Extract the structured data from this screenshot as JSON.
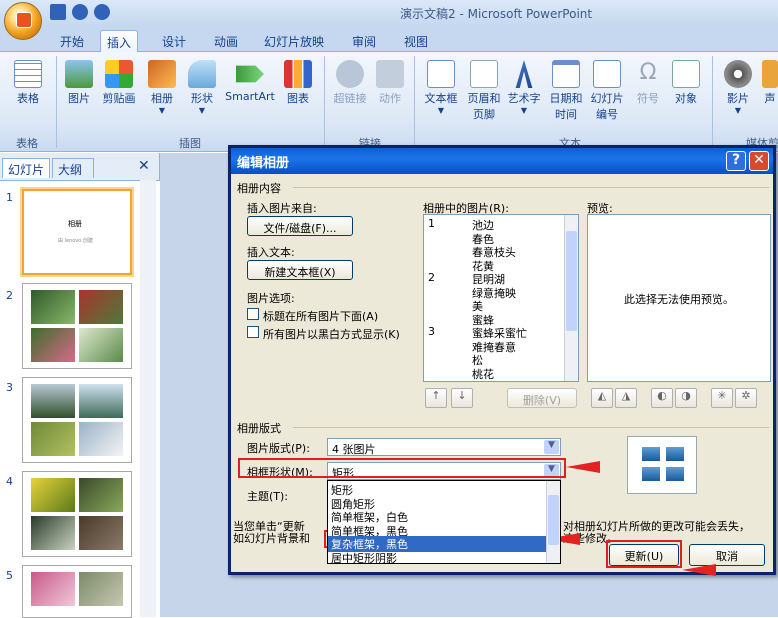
{
  "app": {
    "title": "演示文稿2 - Microsoft PowerPoint"
  },
  "ribbon": {
    "tabs": [
      "开始",
      "插入",
      "设计",
      "动画",
      "幻灯片放映",
      "审阅",
      "视图"
    ],
    "active_tab": "插入",
    "buttons": {
      "table": "表格",
      "picture": "图片",
      "clipart": "剪贴画",
      "album": "相册",
      "shapes": "形状",
      "smartart": "SmartArt",
      "chart": "图表",
      "hyperlink": "超链接",
      "action": "动作",
      "textbox": "文本框",
      "header1": "页眉和",
      "header2": "页脚",
      "wordart": "艺术字",
      "date1": "日期和",
      "date2": "时间",
      "slidenum1": "幻灯片",
      "slidenum2": "编号",
      "symbol": "符号",
      "object": "对象",
      "movie": "影片",
      "sound": "声"
    },
    "groups": {
      "tables": "表格",
      "illustrations": "插图",
      "links": "链接",
      "text": "文本",
      "media": "媒体剪辑"
    }
  },
  "panel": {
    "tab_slides": "幻灯片",
    "tab_outline": "大纲",
    "close": "✕",
    "slide1_title": "相册",
    "slide1_sub": "由 lenovo 创建",
    "slide_numbers": [
      "1",
      "2",
      "3",
      "4",
      "5"
    ]
  },
  "dialog": {
    "title": "编辑相册",
    "help": "?",
    "close": "✕",
    "section_content": "相册内容",
    "insert_from": "插入图片来自:",
    "file_disk_btn": "文件/磁盘(F)...",
    "insert_text": "插入文本:",
    "new_textbox_btn": "新建文本框(X)",
    "picture_options": "图片选项:",
    "opt_caption": "标题在所有图片下面(A)",
    "opt_bw": "所有图片以黑白方式显示(K)",
    "pictures_in_album": "相册中的图片(R):",
    "pictures": [
      {
        "n": "1",
        "name": "池边"
      },
      {
        "n": "",
        "name": "春色"
      },
      {
        "n": "",
        "name": "春意枝头"
      },
      {
        "n": "",
        "name": "花黄"
      },
      {
        "n": "2",
        "name": "昆明湖"
      },
      {
        "n": "",
        "name": "绿意掩映"
      },
      {
        "n": "",
        "name": "美"
      },
      {
        "n": "",
        "name": "蜜蜂"
      },
      {
        "n": "3",
        "name": "蜜蜂采蜜忙"
      },
      {
        "n": "",
        "name": "难掩春意"
      },
      {
        "n": "",
        "name": "松"
      },
      {
        "n": "",
        "name": "桃花"
      }
    ],
    "remove_btn": "删除(V)",
    "preview_label": "预览:",
    "preview_text": "此选择无法使用预览。",
    "section_layout": "相册版式",
    "picture_layout_label": "图片版式(P):",
    "picture_layout_value": "4 张图片",
    "frame_shape_label": "相框形状(M):",
    "frame_shape_value": "矩形",
    "theme_label": "主题(T):",
    "frame_options": [
      "矩形",
      "圆角矩形",
      "简单框架，白色",
      "简单框架，黑色",
      "复杂框架，黑色",
      "居中矩形阴影"
    ],
    "frame_selected": "复杂框架，黑色",
    "note_left1": "当您单击“更新",
    "note_left2": "如幻灯片背景和",
    "note_right1": "对相册幻灯片所做的更改可能会丢失，",
    "note_right2": "这些修改。",
    "update_btn": "更新(U)",
    "cancel_btn": "取消"
  },
  "colors": {
    "accent": "#e02020",
    "title_bar": "#0a5fd9",
    "selection": "#316ac5"
  }
}
